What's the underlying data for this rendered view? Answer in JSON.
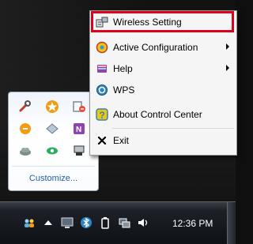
{
  "context_menu": {
    "items": [
      {
        "label": "Wireless Setting",
        "icon": "wireless-setting-icon",
        "highlighted": true,
        "submenu": false
      },
      {
        "label": "Active Configuration",
        "icon": "active-configuration-icon",
        "submenu": true
      },
      {
        "label": "Help",
        "icon": "help-book-icon",
        "submenu": true
      },
      {
        "label": "WPS",
        "icon": "wps-icon",
        "submenu": false
      },
      {
        "label": "About Control Center",
        "icon": "about-question-icon",
        "submenu": false
      },
      {
        "label": "Exit",
        "icon": "exit-x-icon",
        "submenu": false
      }
    ],
    "highlight_color": "#e0001b"
  },
  "tray_overflow": {
    "customize_label": "Customize...",
    "icons": [
      "wrench-icon",
      "star-badge-icon",
      "no-entry-network-icon",
      "orange-circle-icon",
      "diamond-icon",
      "onenote-icon",
      "cloud-icon",
      "green-eye-icon",
      "usb-device-icon"
    ]
  },
  "taskbar": {
    "clock": "12:36 PM",
    "tray_icons": [
      "users-icon",
      "expand-arrow-icon",
      "display-icon",
      "bluetooth-icon",
      "battery-icon",
      "network-icon",
      "speaker-icon"
    ]
  }
}
